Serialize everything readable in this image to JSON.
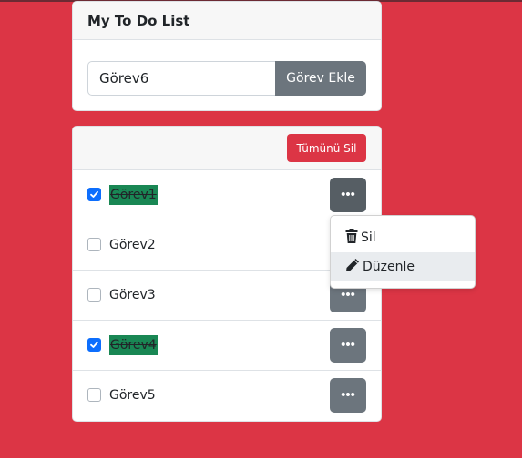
{
  "input_card": {
    "title": "My To Do List",
    "task_input_value": "Görev6",
    "add_button_label": "Görev Ekle"
  },
  "list_card": {
    "clear_all_label": "Tümünü Sil",
    "more_button_label": "•••",
    "tasks": [
      {
        "label": "Görev1",
        "completed": true
      },
      {
        "label": "Görev2",
        "completed": false
      },
      {
        "label": "Görev3",
        "completed": false
      },
      {
        "label": "Görev4",
        "completed": true
      },
      {
        "label": "Görev5",
        "completed": false
      }
    ]
  },
  "dropdown_menu": {
    "open_for_task": "Görev1",
    "items": [
      {
        "label": "Sil",
        "icon": "trash-icon"
      },
      {
        "label": "Düzenle",
        "icon": "pencil-icon"
      }
    ]
  },
  "colors": {
    "background": "#dc3545",
    "secondary": "#6c757d",
    "danger": "#dc3545",
    "checked": "#0d6efd",
    "completed_highlight": "#198754"
  }
}
